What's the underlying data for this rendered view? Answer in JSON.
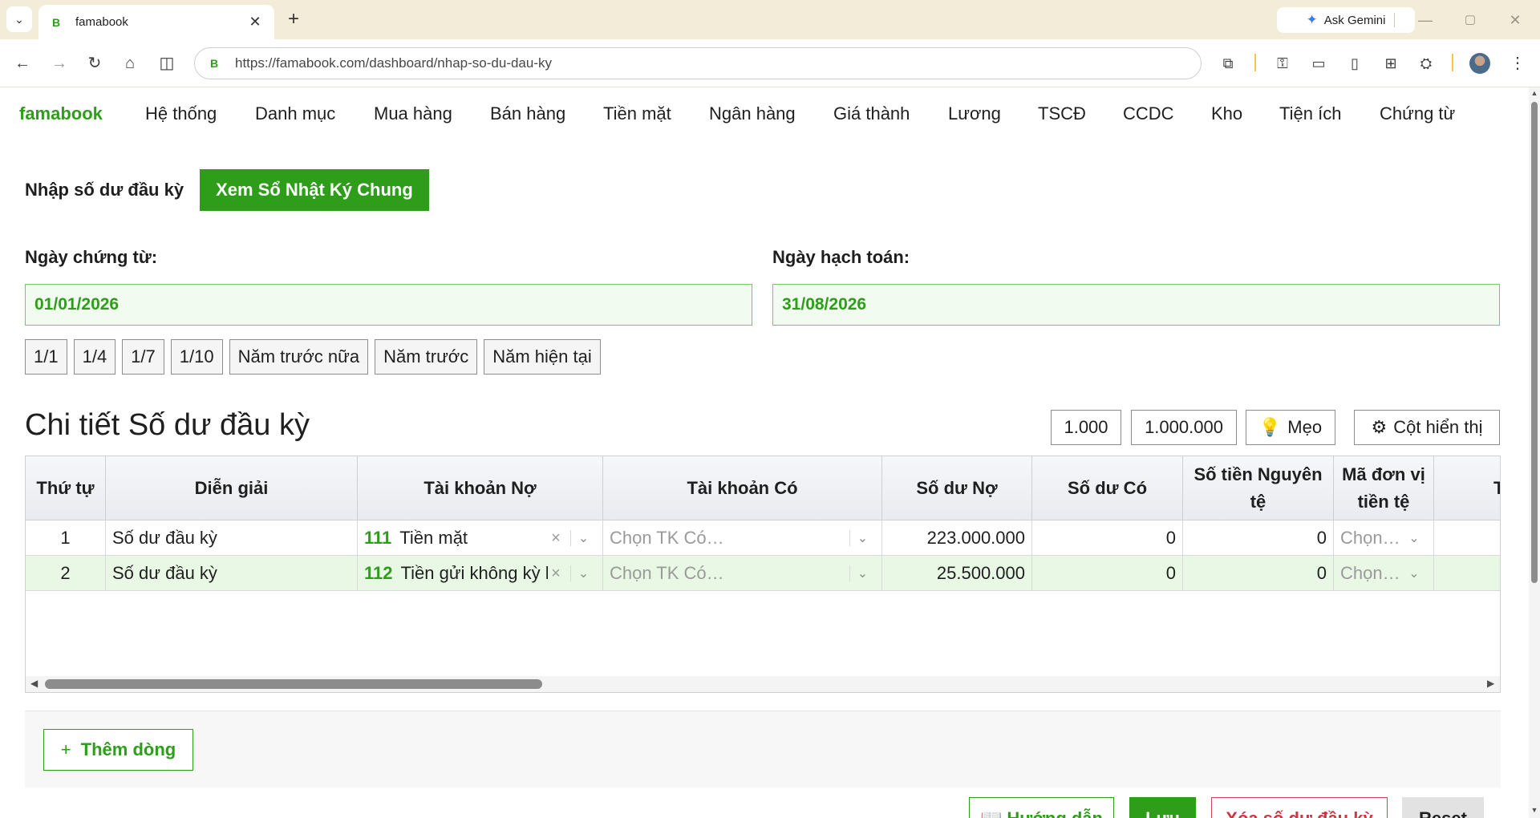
{
  "browser": {
    "tab_title": "famabook",
    "favicon_letter": "B",
    "url": "https://famabook.com/dashboard/nhap-so-du-dau-ky",
    "ask_gemini": "Ask Gemini",
    "win_minimize": "—",
    "win_maximize": "▢",
    "win_close": "✕"
  },
  "nav": {
    "brand": "famabook",
    "items": [
      "Hệ thống",
      "Danh mục",
      "Mua hàng",
      "Bán hàng",
      "Tiền mặt",
      "Ngân hàng",
      "Giá thành",
      "Lương",
      "TSCĐ",
      "CCDC",
      "Kho",
      "Tiện ích",
      "Chứng từ"
    ]
  },
  "header": {
    "label": "Nhập số dư đầu kỳ",
    "journal_button": "Xem Sổ Nhật Ký Chung"
  },
  "dates": {
    "doc_date_label": "Ngày chứng từ:",
    "doc_date_value": "01/01/2026",
    "posting_date_label": "Ngày hạch toán:",
    "posting_date_value": "31/08/2026"
  },
  "quick_dates": [
    "1/1",
    "1/4",
    "1/7",
    "1/10",
    "Năm trước nữa",
    "Năm trước",
    "Năm hiện tại"
  ],
  "section": {
    "title": "Chi tiết Số dư đầu kỳ",
    "fmt_thousand": "1.000",
    "fmt_million": "1.000.000",
    "tips": "Mẹo",
    "columns_button": "Cột hiển thị"
  },
  "table": {
    "headers": [
      "Thứ tự",
      "Diễn giải",
      "Tài khoản Nợ",
      "Tài khoản Có",
      "Số dư Nợ",
      "Số dư Có",
      "Số tiền Nguyên tệ",
      "Mã đơn vị tiền tệ",
      "Tỷ"
    ],
    "rows": [
      {
        "order": "1",
        "desc": "Số dư đầu kỳ",
        "debit_code": "111",
        "debit_name": "Tiền mặt",
        "credit_placeholder": "Chọn TK Có…",
        "debit_balance": "223.000.000",
        "credit_balance": "0",
        "fx_amount": "0",
        "currency_placeholder": "Chọn…"
      },
      {
        "order": "2",
        "desc": "Số dư đầu kỳ",
        "debit_code": "112",
        "debit_name": "Tiền gửi không kỳ hạn",
        "credit_placeholder": "Chọn TK Có…",
        "debit_balance": "25.500.000",
        "credit_balance": "0",
        "fx_amount": "0",
        "currency_placeholder": "Chọn…"
      }
    ]
  },
  "actions": {
    "add_row": "Thêm dòng",
    "guide": "Hướng dẫn",
    "save": "Lưu",
    "delete": "Xóa số dư đầu kỳ",
    "reset": "Reset"
  },
  "colors": {
    "brand_green": "#2e9e1a",
    "danger_red": "#d23444"
  }
}
